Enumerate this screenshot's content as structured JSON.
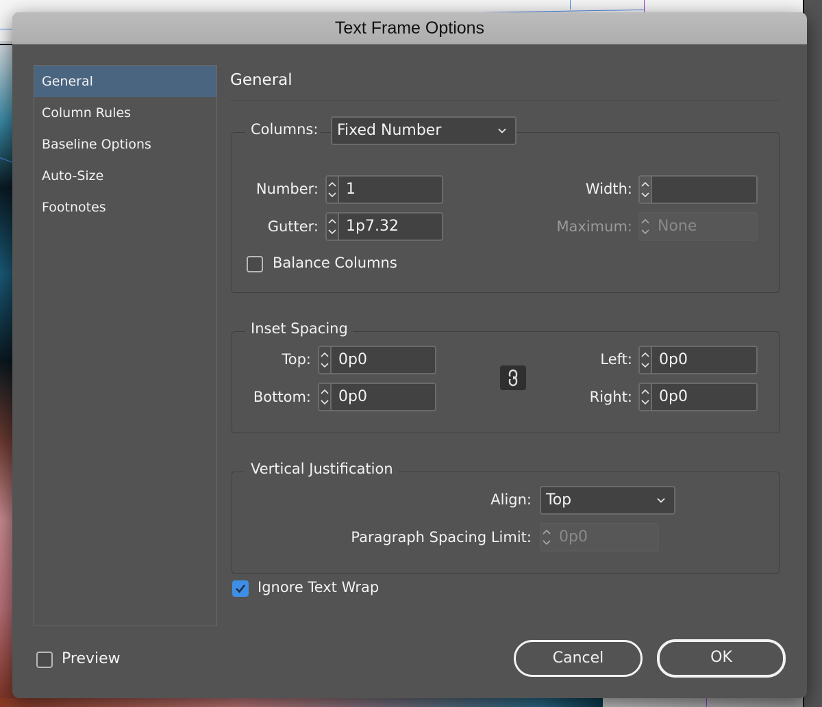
{
  "dialog": {
    "title": "Text Frame Options"
  },
  "sidebar": {
    "items": [
      {
        "label": "General",
        "active": true
      },
      {
        "label": "Column Rules",
        "active": false
      },
      {
        "label": "Baseline Options",
        "active": false
      },
      {
        "label": "Auto-Size",
        "active": false
      },
      {
        "label": "Footnotes",
        "active": false
      }
    ]
  },
  "panel": {
    "title": "General"
  },
  "columns": {
    "label": "Columns:",
    "type_value": "Fixed Number",
    "number_label": "Number:",
    "number_value": "1",
    "gutter_label": "Gutter:",
    "gutter_value": "1p7.32",
    "width_label": "Width:",
    "width_value": "",
    "maximum_label": "Maximum:",
    "maximum_value": "None",
    "balance_label": "Balance Columns",
    "balance_checked": false
  },
  "inset_spacing": {
    "legend": "Inset Spacing",
    "top_label": "Top:",
    "top_value": "0p0",
    "bottom_label": "Bottom:",
    "bottom_value": "0p0",
    "left_label": "Left:",
    "left_value": "0p0",
    "right_label": "Right:",
    "right_value": "0p0",
    "link_icon": "chain-link-icon"
  },
  "vertical_justification": {
    "legend": "Vertical Justification",
    "align_label": "Align:",
    "align_value": "Top",
    "para_spacing_label": "Paragraph Spacing Limit:",
    "para_spacing_value": "0p0"
  },
  "ignore_text_wrap": {
    "label": "Ignore Text Wrap",
    "checked": true
  },
  "footer": {
    "preview_label": "Preview",
    "preview_checked": false,
    "cancel_label": "Cancel",
    "ok_label": "OK"
  },
  "colors": {
    "dialog_bg": "#535353",
    "selected_item": "#4a6580",
    "checkbox_accent": "#3e8ee6"
  }
}
